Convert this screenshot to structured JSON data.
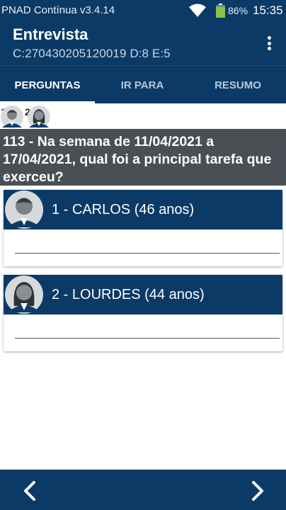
{
  "status_bar": {
    "app_name": "PNAD Contínua v3.4.14",
    "battery": "86%",
    "time": "15:35",
    "icons": [
      "wifi-icon",
      "battery-icon"
    ]
  },
  "app_bar": {
    "title": "Entrevista",
    "subtitle": "C:270430205120019 D:8 E:5",
    "menu_icon": "overflow-menu-icon"
  },
  "tabs": [
    {
      "label": "PERGUNTAS",
      "active": true
    },
    {
      "label": "IR PARA",
      "active": false
    },
    {
      "label": "RESUMO",
      "active": false
    }
  ],
  "people_strip": [
    {
      "number": "1",
      "avatar": "male-avatar-icon"
    },
    {
      "number": "2",
      "avatar": "female-avatar-icon"
    }
  ],
  "question": {
    "text": "113 - Na semana de 11/04/2021 a 17/04/2021, qual foi a principal tarefa que exerceu?"
  },
  "people": [
    {
      "name": "1 - CARLOS (46 anos)",
      "avatar": "male-avatar-icon",
      "answer": ""
    },
    {
      "name": "2 - LOURDES (44 anos)",
      "avatar": "female-avatar-icon",
      "answer": ""
    }
  ],
  "bottom_nav": {
    "prev_icon": "chevron-left-icon",
    "next_icon": "chevron-right-icon"
  },
  "colors": {
    "primary": "#0b3a66",
    "question_bg": "#4a4f55",
    "card_bg": "#ffffff"
  }
}
